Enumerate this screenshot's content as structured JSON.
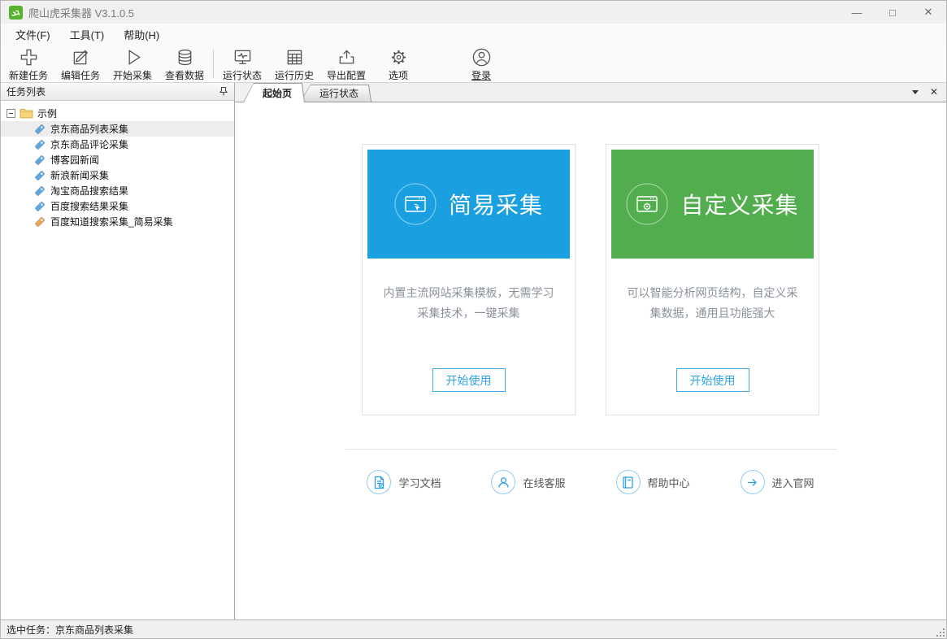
{
  "window": {
    "title": "爬山虎采集器 V3.1.0.5",
    "minimize": "—",
    "maximize": "□",
    "close": "✕"
  },
  "menu": {
    "file": "文件(F)",
    "tools": "工具(T)",
    "help": "帮助(H)"
  },
  "toolbar": {
    "new_task": "新建任务",
    "edit_task": "编辑任务",
    "start_collect": "开始采集",
    "view_data": "查看数据",
    "run_status": "运行状态",
    "run_history": "运行历史",
    "export_config": "导出配置",
    "options": "选项",
    "login": "登录"
  },
  "sidebar": {
    "header": "任务列表",
    "folder_label": "示例",
    "items": [
      {
        "label": "京东商品列表采集",
        "selected": true,
        "tag_color": "#58a9e5"
      },
      {
        "label": "京东商品评论采集",
        "selected": false,
        "tag_color": "#58a9e5"
      },
      {
        "label": "博客园新闻",
        "selected": false,
        "tag_color": "#58a9e5"
      },
      {
        "label": "新浪新闻采集",
        "selected": false,
        "tag_color": "#58a9e5"
      },
      {
        "label": "淘宝商品搜索结果",
        "selected": false,
        "tag_color": "#58a9e5"
      },
      {
        "label": "百度搜索结果采集",
        "selected": false,
        "tag_color": "#58a9e5"
      },
      {
        "label": "百度知道搜索采集_简易采集",
        "selected": false,
        "tag_color": "#f0a24d"
      }
    ]
  },
  "tabs": {
    "start_page": "起始页",
    "run_status": "运行状态"
  },
  "cards": [
    {
      "title": "简易采集",
      "color": "#1a9fe0",
      "description": "内置主流网站采集模板，无需学习采集技术，一键采集",
      "button": "开始使用"
    },
    {
      "title": "自定义采集",
      "color": "#52ad4e",
      "description": "可以智能分析网页结构，自定义采集数据，通用且功能强大",
      "button": "开始使用"
    }
  ],
  "links": [
    {
      "label": "学习文档"
    },
    {
      "label": "在线客服"
    },
    {
      "label": "帮助中心"
    },
    {
      "label": "进入官网"
    }
  ],
  "statusbar": {
    "text": "选中任务：京东商品列表采集"
  }
}
